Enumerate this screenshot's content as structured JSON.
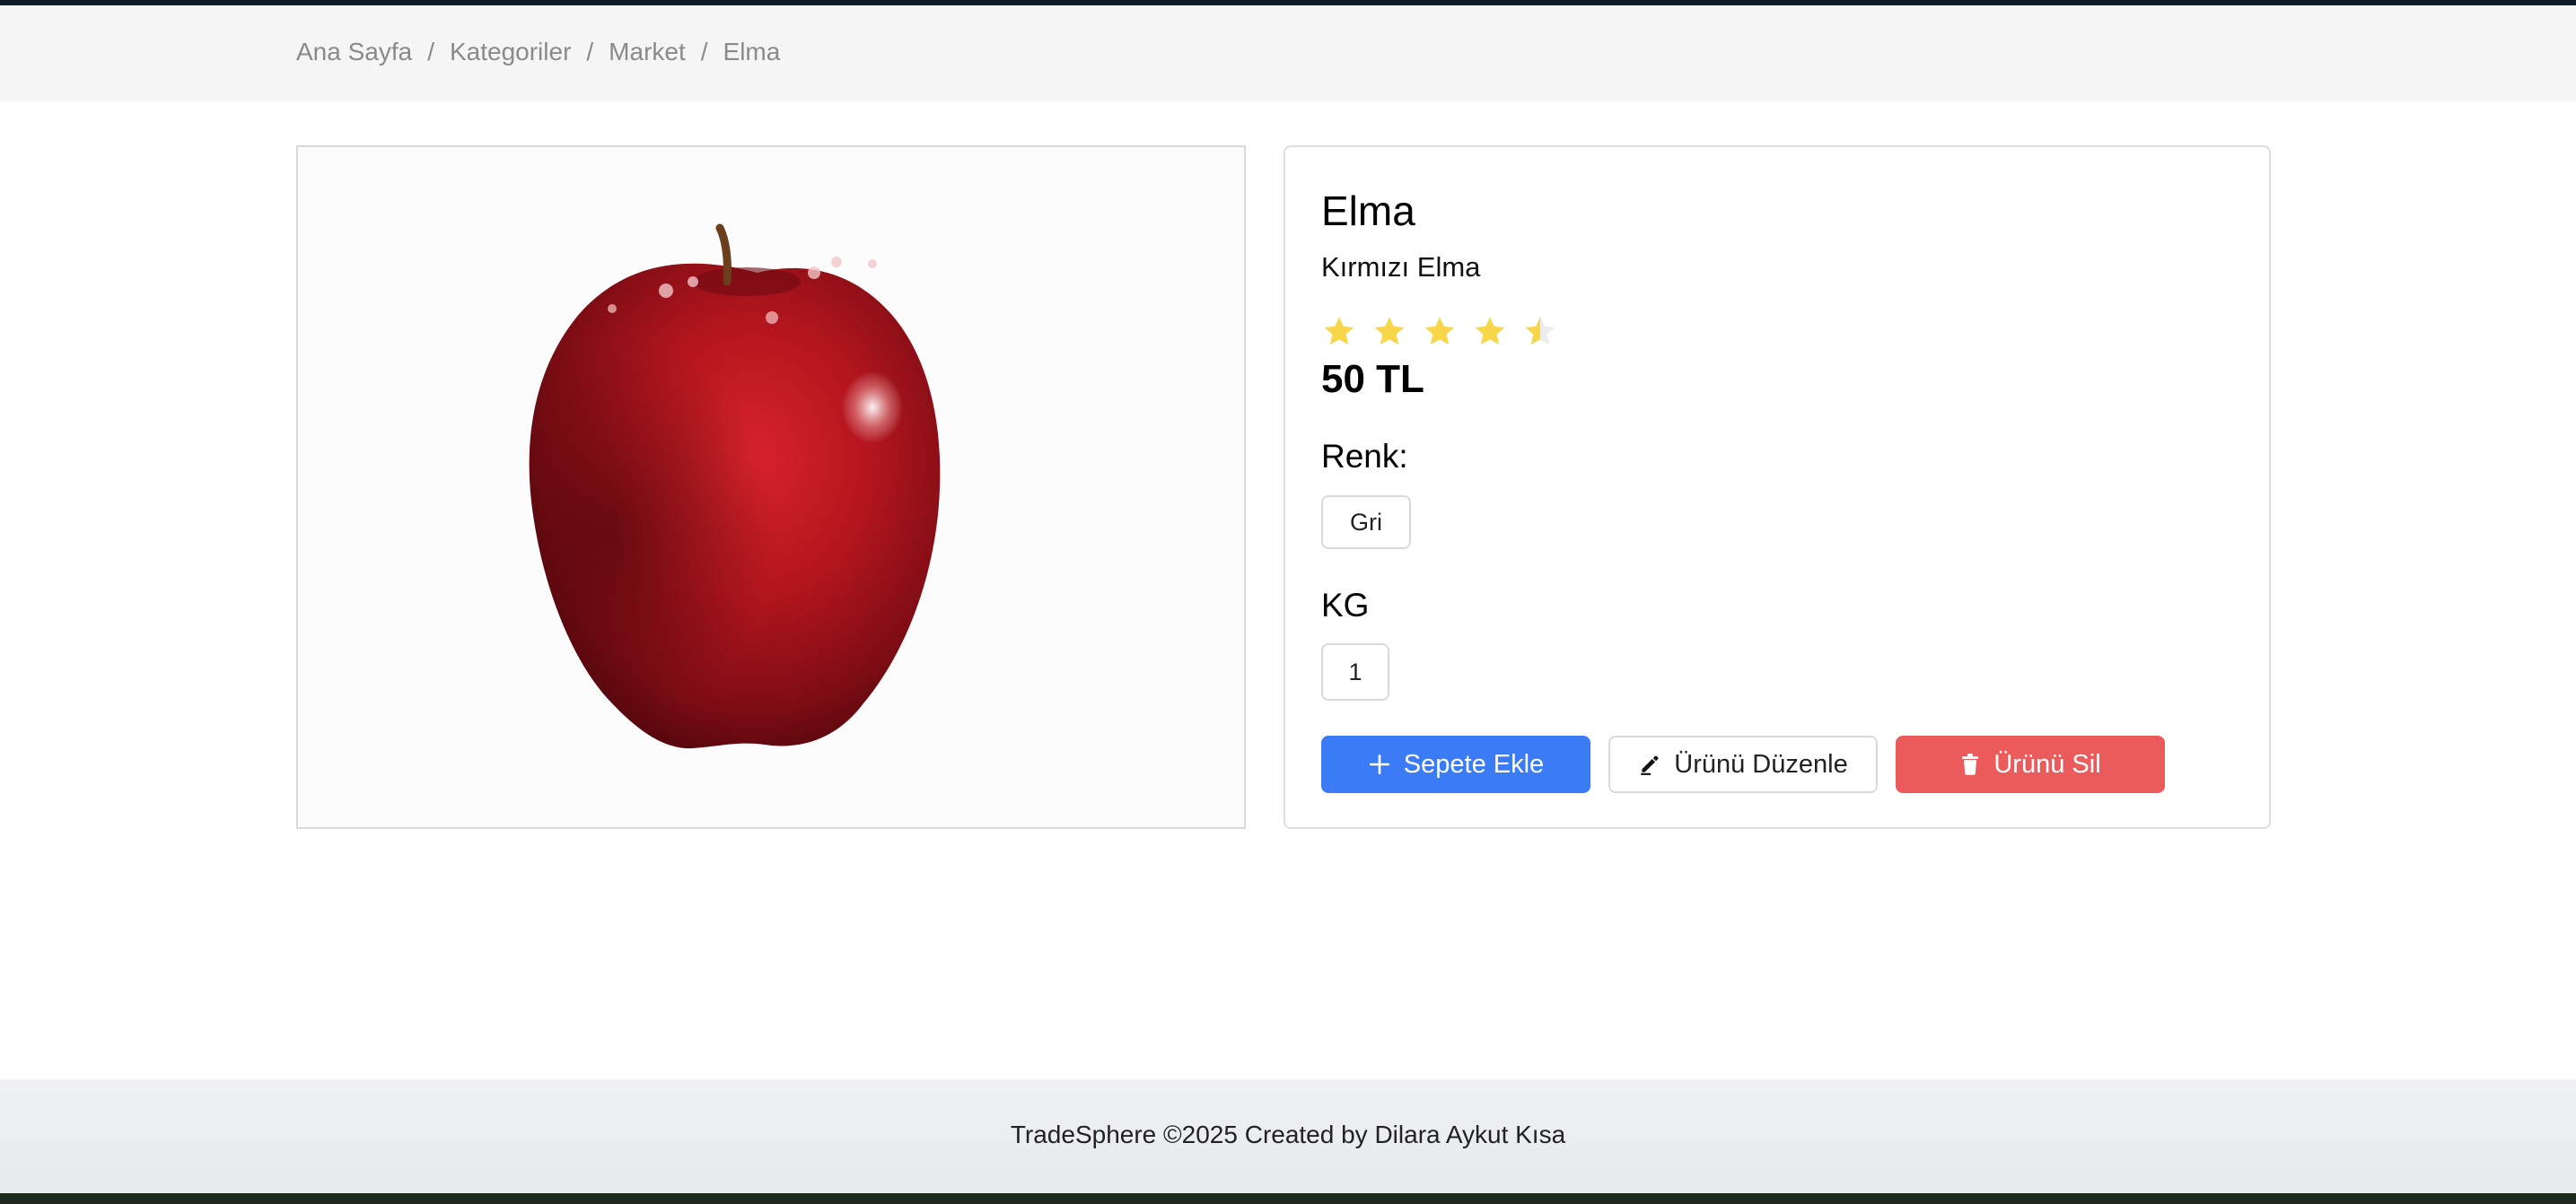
{
  "breadcrumb": {
    "items": [
      "Ana Sayfa",
      "Kategoriler",
      "Market",
      "Elma"
    ],
    "separator": "/"
  },
  "product": {
    "image_icon": "apple-photo",
    "title": "Elma",
    "subtitle": "Kırmızı Elma",
    "rating": 4.5,
    "rating_max": 5,
    "price": "50 TL",
    "color_label": "Renk:",
    "color_value": "Gri",
    "quantity_label": "KG",
    "quantity_value": "1"
  },
  "actions": {
    "add_to_cart": "Sepete Ekle",
    "edit": "Ürünü Düzenle",
    "delete": "Ürünü Sil"
  },
  "footer": {
    "text": "TradeSphere ©2025 Created by Dilara Aykut Kısa"
  },
  "colors": {
    "primary": "#3b7cf6",
    "danger": "#eb5b5b",
    "star": "#f7d64a"
  }
}
